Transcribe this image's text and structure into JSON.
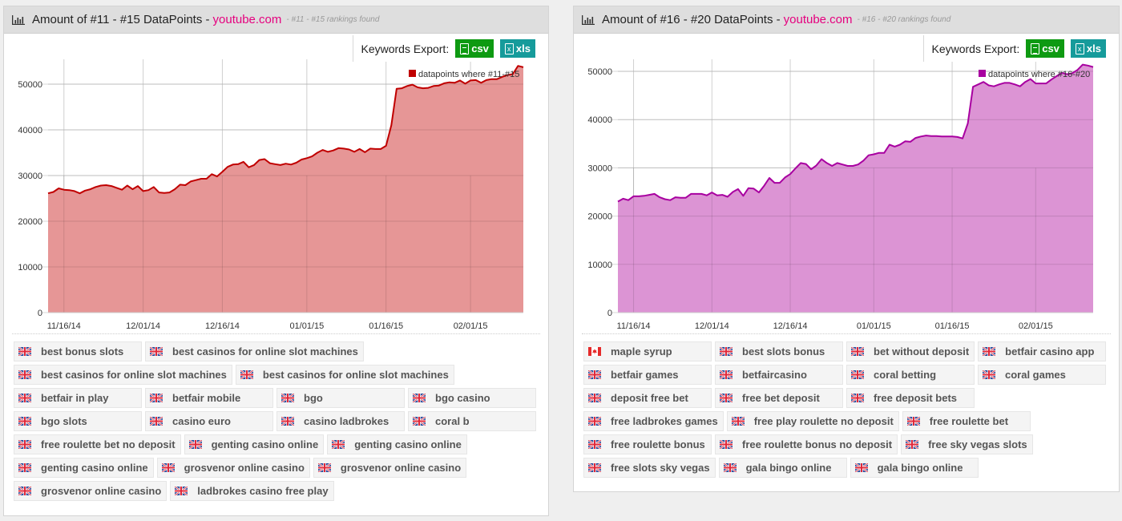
{
  "panels": [
    {
      "id": "left",
      "title": "Amount of #11 - #15 DataPoints - ",
      "domain": "youtube.com",
      "subtitle": "- #11 - #15 rankings found",
      "export_label": "Keywords Export:",
      "csv_label": "csv",
      "xls_label": "xls",
      "keywords": [
        {
          "flag": "uk",
          "text": "best bonus slots"
        },
        {
          "flag": "uk",
          "text": "best casinos for online slot machines"
        },
        {
          "flag": "uk",
          "text": "best casinos for online slot machines"
        },
        {
          "flag": "uk",
          "text": "best casinos for online slot machines"
        },
        {
          "flag": "uk",
          "text": "betfair in play"
        },
        {
          "flag": "uk",
          "text": "betfair mobile"
        },
        {
          "flag": "uk",
          "text": "bgo"
        },
        {
          "flag": "uk",
          "text": "bgo casino"
        },
        {
          "flag": "uk",
          "text": "bgo slots"
        },
        {
          "flag": "uk",
          "text": "casino euro"
        },
        {
          "flag": "uk",
          "text": "casino ladbrokes"
        },
        {
          "flag": "uk",
          "text": "coral b"
        },
        {
          "flag": "uk",
          "text": "free roulette bet no deposit"
        },
        {
          "flag": "uk",
          "text": "genting casino online"
        },
        {
          "flag": "uk",
          "text": "genting casino online"
        },
        {
          "flag": "uk",
          "text": "genting casino online"
        },
        {
          "flag": "uk",
          "text": "grosvenor online casino"
        },
        {
          "flag": "uk",
          "text": "grosvenor online casino"
        },
        {
          "flag": "uk",
          "text": "grosvenor online casino"
        },
        {
          "flag": "uk",
          "text": "ladbrokes casino free play"
        }
      ]
    },
    {
      "id": "right",
      "title": "Amount of #16 - #20 DataPoints - ",
      "domain": "youtube.com",
      "subtitle": "- #16 - #20 rankings found",
      "export_label": "Keywords Export:",
      "csv_label": "csv",
      "xls_label": "xls",
      "keywords": [
        {
          "flag": "ca",
          "text": "maple syrup"
        },
        {
          "flag": "uk",
          "text": "best slots bonus"
        },
        {
          "flag": "uk",
          "text": "bet without deposit"
        },
        {
          "flag": "uk",
          "text": "betfair casino app"
        },
        {
          "flag": "uk",
          "text": "betfair games"
        },
        {
          "flag": "uk",
          "text": "betfaircasino"
        },
        {
          "flag": "uk",
          "text": "coral betting"
        },
        {
          "flag": "uk",
          "text": "coral games"
        },
        {
          "flag": "uk",
          "text": "deposit free bet"
        },
        {
          "flag": "uk",
          "text": "free bet deposit"
        },
        {
          "flag": "uk",
          "text": "free deposit bets"
        },
        {
          "flag": "uk",
          "text": "free ladbrokes games"
        },
        {
          "flag": "uk",
          "text": "free play roulette no deposit"
        },
        {
          "flag": "uk",
          "text": "free roulette bet"
        },
        {
          "flag": "uk",
          "text": "free roulette bonus"
        },
        {
          "flag": "uk",
          "text": "free roulette bonus no deposit"
        },
        {
          "flag": "uk",
          "text": "free sky vegas slots"
        },
        {
          "flag": "uk",
          "text": "free slots sky vegas"
        },
        {
          "flag": "uk",
          "text": "gala bingo online"
        },
        {
          "flag": "uk",
          "text": "gala bingo online"
        }
      ]
    }
  ],
  "colors": {
    "domain_pink": "#e5007e",
    "csv_green": "#0e9a12",
    "xls_teal": "#169b9b",
    "series_left_line": "#c00000",
    "series_left_fill": "#e69696",
    "series_right_line": "#a800a0",
    "series_right_fill": "#dc94d4"
  },
  "chart_data": [
    {
      "type": "area",
      "title": "Amount of #11 - #15 DataPoints",
      "xlabel": "",
      "ylabel": "",
      "ylim": [
        0,
        55000
      ],
      "yticks": [
        0,
        10000,
        20000,
        30000,
        40000,
        50000
      ],
      "xticks": [
        "11/16/14",
        "12/01/14",
        "12/16/14",
        "01/01/15",
        "01/16/15",
        "02/01/15"
      ],
      "x_start": "11/13/14",
      "x_end": "02/12/15",
      "grid": true,
      "legend": {
        "position": "top-right",
        "entries": [
          "datapoints where #11-#15"
        ]
      },
      "series": [
        {
          "name": "datapoints where #11-#15",
          "values": [
            26100,
            26400,
            27200,
            26900,
            26800,
            26600,
            26100,
            26700,
            27000,
            27500,
            27800,
            27900,
            27700,
            27300,
            26900,
            27800,
            27000,
            27700,
            26600,
            26800,
            27500,
            26300,
            26200,
            26300,
            27000,
            28000,
            27900,
            28700,
            29000,
            29300,
            29300,
            30300,
            29800,
            30800,
            31900,
            32400,
            32500,
            33000,
            31800,
            32300,
            33400,
            33600,
            32700,
            32500,
            32300,
            32600,
            32400,
            32800,
            33500,
            33800,
            34200,
            35000,
            35600,
            35200,
            35500,
            36000,
            35900,
            35700,
            35200,
            35800,
            35100,
            35900,
            35800,
            35800,
            36500,
            41000,
            49000,
            49100,
            49600,
            49900,
            49300,
            49100,
            49200,
            49600,
            49700,
            50200,
            50400,
            50300,
            50800,
            50100,
            50800,
            50900,
            50300,
            50900,
            51100,
            51100,
            51600,
            52000,
            52200,
            54000,
            53700
          ]
        }
      ]
    },
    {
      "type": "area",
      "title": "Amount of #16 - #20 DataPoints",
      "xlabel": "",
      "ylabel": "",
      "ylim": [
        0,
        52000
      ],
      "yticks": [
        0,
        10000,
        20000,
        30000,
        40000,
        50000
      ],
      "xticks": [
        "11/16/14",
        "12/01/14",
        "12/16/14",
        "01/01/15",
        "01/16/15",
        "02/01/15"
      ],
      "x_start": "11/13/14",
      "x_end": "02/12/15",
      "grid": true,
      "legend": {
        "position": "top-right",
        "entries": [
          "datapoints where #16-#20"
        ]
      },
      "series": [
        {
          "name": "datapoints where #16-#20",
          "values": [
            23000,
            23600,
            23300,
            24100,
            24100,
            24200,
            24400,
            24600,
            23900,
            23500,
            23300,
            23900,
            23800,
            23800,
            24600,
            24600,
            24600,
            24300,
            24900,
            24300,
            24400,
            24000,
            25000,
            25600,
            24200,
            25800,
            25700,
            24900,
            26300,
            27900,
            26900,
            26900,
            28000,
            28700,
            29900,
            31000,
            30800,
            29700,
            30500,
            31800,
            31000,
            30400,
            31000,
            30700,
            30400,
            30400,
            30700,
            31500,
            32600,
            32800,
            33100,
            33100,
            34800,
            34400,
            34800,
            35500,
            35400,
            36200,
            36500,
            36700,
            36600,
            36600,
            36500,
            36500,
            36500,
            36400,
            36100,
            39200,
            46800,
            47300,
            47800,
            47100,
            46900,
            47300,
            47600,
            47600,
            47300,
            46900,
            47800,
            48400,
            47500,
            47500,
            47500,
            48300,
            49000,
            49700,
            49400,
            49600,
            50300,
            51400,
            51200,
            50900
          ]
        }
      ]
    }
  ]
}
